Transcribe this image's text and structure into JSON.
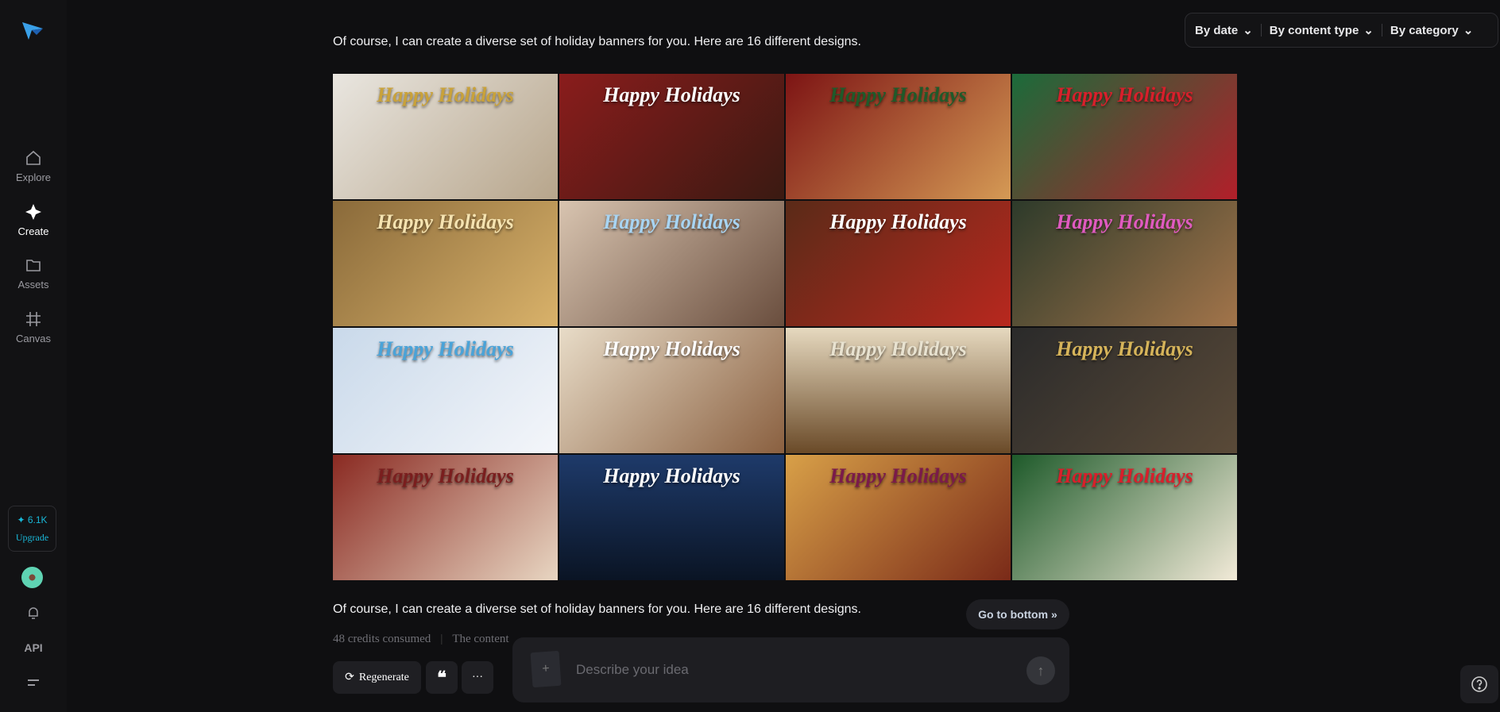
{
  "sidebar": {
    "items": [
      {
        "label": "Explore"
      },
      {
        "label": "Create"
      },
      {
        "label": "Assets"
      },
      {
        "label": "Canvas"
      }
    ],
    "credits": "6.1K",
    "upgrade": "Upgrade",
    "api": "API"
  },
  "filters": [
    "By date",
    "By content type",
    "By category"
  ],
  "message": "Of course, I can create a diverse set of holiday banners for you. Here are 16 different designs.",
  "tiles": [
    {
      "caption": "Happy Holidays",
      "bg": "linear-gradient(135deg,#e9e6e0,#b7a58b)",
      "color": "#c9a23a"
    },
    {
      "caption": "Happy Holidays",
      "bg": "linear-gradient(135deg,#8a1c1c,#3a1a12)",
      "color": "#ffffff"
    },
    {
      "caption": "Happy Holidays",
      "bg": "linear-gradient(135deg,#7d1414,#d59a55)",
      "color": "#1f5a2a"
    },
    {
      "caption": "Happy Holidays",
      "bg": "linear-gradient(135deg,#1b6b3a,#b21f2a)",
      "color": "#d81f2b"
    },
    {
      "caption": "Happy Holidays",
      "bg": "linear-gradient(135deg,#8a6a3a,#d9b26a)",
      "color": "#f5e3b0"
    },
    {
      "caption": "Happy Holidays",
      "bg": "linear-gradient(135deg,#d8c4b0,#6a4e3e)",
      "color": "#a8d4f2"
    },
    {
      "caption": "Happy Holidays",
      "bg": "linear-gradient(135deg,#5a2a18,#b8281e)",
      "color": "#ffffff"
    },
    {
      "caption": "Happy Holidays",
      "bg": "linear-gradient(135deg,#2d3a2a,#a2744a)",
      "color": "#e05ac0"
    },
    {
      "caption": "Happy Holidays",
      "bg": "linear-gradient(135deg,#c9d9ea,#f4f6fa)",
      "color": "#4aa3d8"
    },
    {
      "caption": "Happy Holidays",
      "bg": "linear-gradient(135deg,#e8dcc8,#8a6040)",
      "color": "#ffffff"
    },
    {
      "caption": "Happy Holidays",
      "bg": "linear-gradient(180deg,#e6d9bf,#6a4a28)",
      "color": "#e8e2d0"
    },
    {
      "caption": "Happy Holidays",
      "bg": "linear-gradient(135deg,#2a2a2a,#5a4a38)",
      "color": "#d6b45a"
    },
    {
      "caption": "Happy Holidays",
      "bg": "linear-gradient(135deg,#8a2a22,#e8d6c2)",
      "color": "#7a1e1e"
    },
    {
      "caption": "Happy Holidays",
      "bg": "linear-gradient(180deg,#1e3a6a,#0a1424)",
      "color": "#ffffff"
    },
    {
      "caption": "Happy Holidays",
      "bg": "linear-gradient(135deg,#d8a048,#7a2a18)",
      "color": "#7a1a4a"
    },
    {
      "caption": "Happy Holidays",
      "bg": "linear-gradient(135deg,#1e5a2a,#f2ead8)",
      "color": "#d81f2b"
    }
  ],
  "footer": {
    "credits": "48 credits consumed",
    "notice": "The content",
    "regenerate": "Regenerate"
  },
  "composer": {
    "placeholder": "Describe your idea"
  },
  "go_to_bottom": "Go to bottom"
}
